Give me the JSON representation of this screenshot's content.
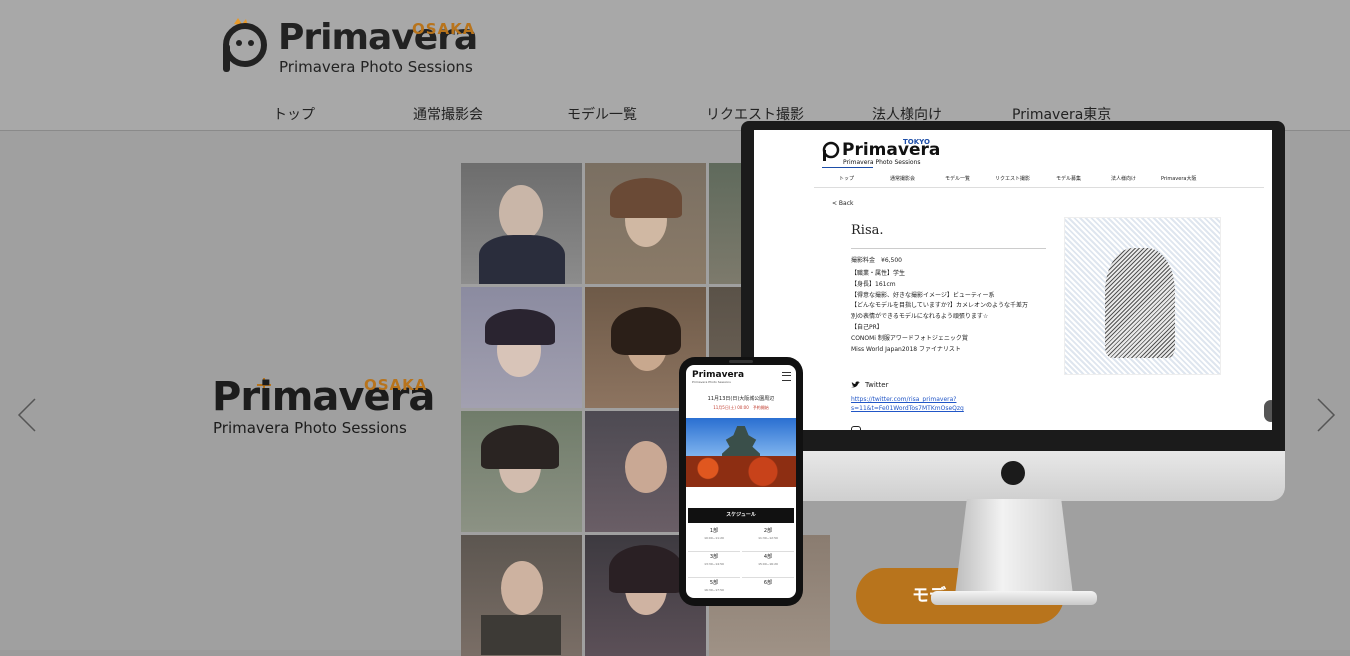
{
  "site": {
    "logo_region": "OSAKA",
    "logo_brand": "Primavera",
    "logo_sub": "Primavera Photo Sessions"
  },
  "nav": {
    "items": [
      {
        "label": "トップ"
      },
      {
        "label": "通常撮影会"
      },
      {
        "label": "モデル一覧"
      },
      {
        "label": "リクエスト撮影"
      },
      {
        "label": "法人様向け"
      },
      {
        "label": "Primavera東京"
      }
    ]
  },
  "hero": {
    "logo_region": "OSAKA",
    "logo_brand": "Primavera",
    "logo_sub": "Primavera Photo Sessions",
    "cta_label": "モデ",
    "prev_icon": "chevron-left-icon",
    "next_icon": "chevron-right-icon"
  },
  "imac_screen": {
    "logo_region": "TOKYO",
    "logo_brand": "Primavera",
    "logo_sub": "Primavera Photo Sessions",
    "nav": [
      "トップ",
      "通常撮影会",
      "モデル一覧",
      "リクエスト撮影",
      "モデル募集",
      "法人様向け",
      "Primavera大阪"
    ],
    "back": "< Back",
    "model_name": "Risa.",
    "fee": "撮影料金　¥6,500",
    "profile_lines": [
      "【職業・属性】学生",
      "【身長】161cm",
      "【得意な撮影、好きな撮影イメージ】ビューティー系",
      "【どんなモデルを目指していますか?】カメレオンのような千差万",
      "別の表情ができるモデルになれるよう頑張ります☆",
      "【自己PR】",
      "CONOMi 制服アワードフォトジェニック賞",
      "Miss World Japan2018 ファイナリスト"
    ],
    "twitter_label": "Twitter",
    "twitter_link": "https://twitter.com/risa_primavera?s=11&t=Fe01WordTos7MTKmOseQzg"
  },
  "phone_screen": {
    "logo_brand": "Primavera",
    "logo_sub": "Primavera Photo Sessions",
    "event_title": "11月13日(日)大阪城公園周辺",
    "event_date": "11月5日(土) 00:00　予約開始",
    "schedule_label": "スケジュール",
    "slots": [
      {
        "part": "1部",
        "time": "10:00~11:20"
      },
      {
        "part": "2部",
        "time": "11:30~12:50"
      },
      {
        "part": "3部",
        "time": "13:30~14:50"
      },
      {
        "part": "4部",
        "time": "15:00~16:20"
      },
      {
        "part": "5部",
        "time": "16:30~17:50"
      },
      {
        "part": "6部",
        "time": ""
      }
    ]
  },
  "colors": {
    "accent": "#b8741c",
    "overlay_bg": "#9b9b9b",
    "tokyo_blue": "#1d4ea8"
  }
}
